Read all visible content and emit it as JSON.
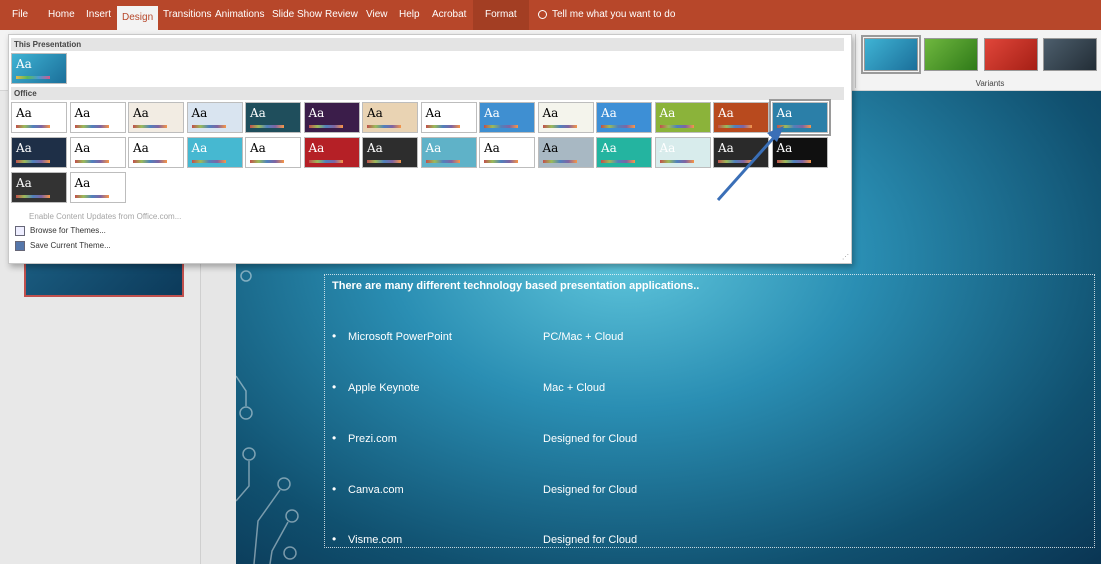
{
  "ribbon": {
    "tabs": [
      "File",
      "Home",
      "Insert",
      "Design",
      "Transitions",
      "Animations",
      "Slide Show",
      "Review",
      "View",
      "Help",
      "Acrobat",
      "Format"
    ],
    "active_tab": "Design",
    "tell_me": "Tell me what you want to do",
    "variants_label": "Variants"
  },
  "gallery": {
    "this_presentation_header": "This Presentation",
    "office_header": "Office",
    "aa": "Aa",
    "menu": {
      "enable_updates": "Enable Content Updates from Office.com...",
      "browse": "Browse for Themes...",
      "save": "Save Current Theme..."
    }
  },
  "slide": {
    "heading": "There are many different technology based presentation applications..",
    "bullet_char": "•",
    "rows": [
      {
        "app": "Microsoft PowerPoint",
        "platform": "PC/Mac + Cloud"
      },
      {
        "app": "Apple Keynote",
        "platform": "Mac + Cloud"
      },
      {
        "app": "Prezi.com",
        "platform": "Designed for Cloud"
      },
      {
        "app": "Canva.com",
        "platform": "Designed for Cloud"
      },
      {
        "app": "Visme.com",
        "platform": "Designed for Cloud"
      }
    ]
  },
  "colors": {
    "ribbon_accent": "#b7472a",
    "annotation_arrow": "#3a6fb7"
  },
  "icons": [
    "lightbulb-icon",
    "browse-themes-icon",
    "save-theme-icon",
    "annotation-arrow"
  ]
}
